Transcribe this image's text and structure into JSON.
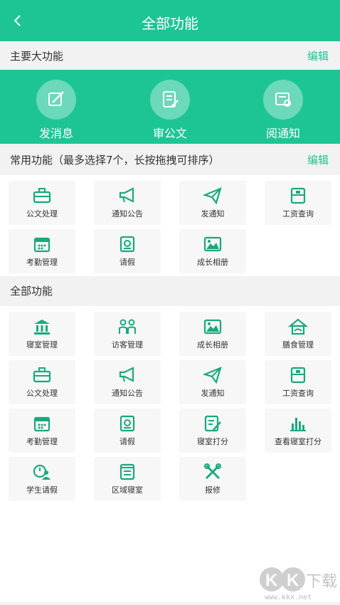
{
  "header": {
    "title": "全部功能",
    "back_icon": "chevron-left-icon"
  },
  "colors": {
    "accent": "#1dc595",
    "icon": "#1aa97e"
  },
  "main_section": {
    "label": "主要大功能",
    "edit_label": "编辑",
    "items": [
      {
        "label": "发消息",
        "icon": "pen-edit-icon"
      },
      {
        "label": "审公文",
        "icon": "document-edit-icon"
      },
      {
        "label": "阅通知",
        "icon": "notice-read-icon"
      }
    ]
  },
  "common_section": {
    "label": "常用功能（最多选择7个，长按拖拽可排序）",
    "edit_label": "编辑",
    "items": [
      {
        "label": "公文处理",
        "icon": "briefcase-icon"
      },
      {
        "label": "通知公告",
        "icon": "megaphone-icon"
      },
      {
        "label": "发通知",
        "icon": "paper-plane-icon"
      },
      {
        "label": "工资查询",
        "icon": "salary-icon"
      },
      {
        "label": "考勤管理",
        "icon": "calendar-icon"
      },
      {
        "label": "请假",
        "icon": "leave-icon"
      },
      {
        "label": "成长相册",
        "icon": "photo-album-icon"
      }
    ]
  },
  "all_section": {
    "label": "全部功能",
    "items": [
      {
        "label": "寝室管理",
        "icon": "building-icon"
      },
      {
        "label": "访客管理",
        "icon": "visitors-icon"
      },
      {
        "label": "成长相册",
        "icon": "photo-album-icon"
      },
      {
        "label": "膳食管理",
        "icon": "food-icon"
      },
      {
        "label": "公文处理",
        "icon": "briefcase-icon"
      },
      {
        "label": "通知公告",
        "icon": "megaphone-icon"
      },
      {
        "label": "发通知",
        "icon": "paper-plane-icon"
      },
      {
        "label": "工资查询",
        "icon": "salary-icon"
      },
      {
        "label": "考勤管理",
        "icon": "calendar-icon"
      },
      {
        "label": "请假",
        "icon": "leave-icon"
      },
      {
        "label": "寝室打分",
        "icon": "score-edit-icon"
      },
      {
        "label": "查看寝室打分",
        "icon": "bar-chart-icon"
      },
      {
        "label": "学生请假",
        "icon": "student-leave-icon"
      },
      {
        "label": "区域寝室",
        "icon": "scroll-icon"
      },
      {
        "label": "报修",
        "icon": "tools-icon"
      }
    ]
  },
  "watermark": {
    "logo_text": "KK下载",
    "url": "www.kkx.net"
  }
}
